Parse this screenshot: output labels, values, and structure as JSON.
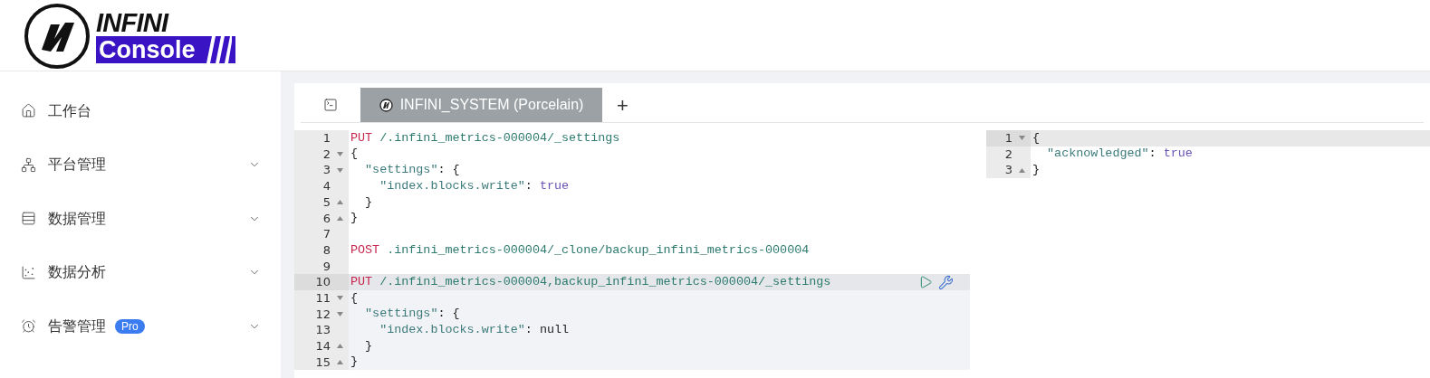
{
  "logo": {
    "top": "INFINI",
    "bottom": "Console"
  },
  "sidebar": {
    "items": [
      {
        "kind": "home",
        "label": "工作台",
        "expandable": false
      },
      {
        "kind": "platform",
        "label": "平台管理",
        "expandable": true
      },
      {
        "kind": "data",
        "label": "数据管理",
        "expandable": true
      },
      {
        "kind": "analysis",
        "label": "数据分析",
        "expandable": true
      },
      {
        "kind": "alert",
        "label": "告警管理",
        "badge": "Pro",
        "expandable": true
      }
    ]
  },
  "tabs": [
    {
      "label": "INFINI_SYSTEM (Porcelain)",
      "selected": true
    }
  ],
  "add_tab": "+",
  "request_editor": {
    "lines": [
      {
        "number": "1",
        "fold_start": false,
        "fold_end": false,
        "active": false,
        "current": false,
        "tokens": [
          {
            "kind": "method",
            "text": "PUT"
          },
          {
            "kind": "path",
            "text": " /.infini_metrics-000004/_settings"
          }
        ]
      },
      {
        "number": "2",
        "fold_start": true,
        "fold_end": false,
        "active": false,
        "current": false,
        "tokens": [
          {
            "kind": "punct",
            "text": "{"
          }
        ]
      },
      {
        "number": "3",
        "fold_start": true,
        "fold_end": false,
        "active": false,
        "current": false,
        "tokens": [
          {
            "kind": "key",
            "text": "  \"settings\""
          },
          {
            "kind": "punct",
            "text": ": {"
          }
        ]
      },
      {
        "number": "4",
        "fold_start": false,
        "fold_end": false,
        "active": false,
        "current": false,
        "tokens": [
          {
            "kind": "key",
            "text": "    \"index.blocks.write\""
          },
          {
            "kind": "punct",
            "text": ": "
          },
          {
            "kind": "bool",
            "text": "true"
          }
        ]
      },
      {
        "number": "5",
        "fold_start": false,
        "fold_end": true,
        "active": false,
        "current": false,
        "tokens": [
          {
            "kind": "punct",
            "text": "  }"
          }
        ]
      },
      {
        "number": "6",
        "fold_start": false,
        "fold_end": true,
        "active": false,
        "current": false,
        "tokens": [
          {
            "kind": "punct",
            "text": "}"
          }
        ]
      },
      {
        "number": "7",
        "fold_start": false,
        "fold_end": false,
        "active": false,
        "current": false
      },
      {
        "number": "8",
        "fold_start": false,
        "fold_end": false,
        "active": false,
        "current": false,
        "tokens": [
          {
            "kind": "method",
            "text": "POST"
          },
          {
            "kind": "path",
            "text": " .infini_metrics-000004/_clone/backup_infini_metrics-000004"
          }
        ]
      },
      {
        "number": "9",
        "fold_start": false,
        "fold_end": false,
        "active": false,
        "current": false
      },
      {
        "number": "10",
        "fold_start": false,
        "fold_end": false,
        "active": true,
        "current": true,
        "tokens": [
          {
            "kind": "method",
            "text": "PUT"
          },
          {
            "kind": "path",
            "text": " /.infini_metrics-000004,backup_infini_metrics-000004/_settings"
          }
        ]
      },
      {
        "number": "11",
        "fold_start": true,
        "fold_end": false,
        "active": false,
        "current": true,
        "tokens": [
          {
            "kind": "punct",
            "text": "{"
          }
        ]
      },
      {
        "number": "12",
        "fold_start": true,
        "fold_end": false,
        "active": false,
        "current": true,
        "tokens": [
          {
            "kind": "key",
            "text": "  \"settings\""
          },
          {
            "kind": "punct",
            "text": ": {"
          }
        ]
      },
      {
        "number": "13",
        "fold_start": false,
        "fold_end": false,
        "active": false,
        "current": true,
        "tokens": [
          {
            "kind": "key",
            "text": "    \"index.blocks.write\""
          },
          {
            "kind": "punct",
            "text": ": null"
          }
        ]
      },
      {
        "number": "14",
        "fold_start": false,
        "fold_end": true,
        "active": false,
        "current": true,
        "tokens": [
          {
            "kind": "punct",
            "text": "  }"
          }
        ]
      },
      {
        "number": "15",
        "fold_start": false,
        "fold_end": true,
        "active": false,
        "current": true,
        "tokens": [
          {
            "kind": "punct",
            "text": "}"
          }
        ]
      }
    ]
  },
  "response_viewer": {
    "lines": [
      {
        "number": "1",
        "fold_start": true,
        "fold_end": false,
        "active": true,
        "current": false,
        "tokens": [
          {
            "kind": "punct",
            "text": "{"
          }
        ]
      },
      {
        "number": "2",
        "fold_start": false,
        "fold_end": false,
        "active": false,
        "current": false,
        "tokens": [
          {
            "kind": "key",
            "text": "  \"acknowledged\""
          },
          {
            "kind": "punct",
            "text": ": "
          },
          {
            "kind": "bool",
            "text": "true"
          }
        ]
      },
      {
        "number": "3",
        "fold_start": false,
        "fold_end": true,
        "active": false,
        "current": false,
        "tokens": [
          {
            "kind": "punct",
            "text": "}"
          }
        ]
      }
    ]
  }
}
